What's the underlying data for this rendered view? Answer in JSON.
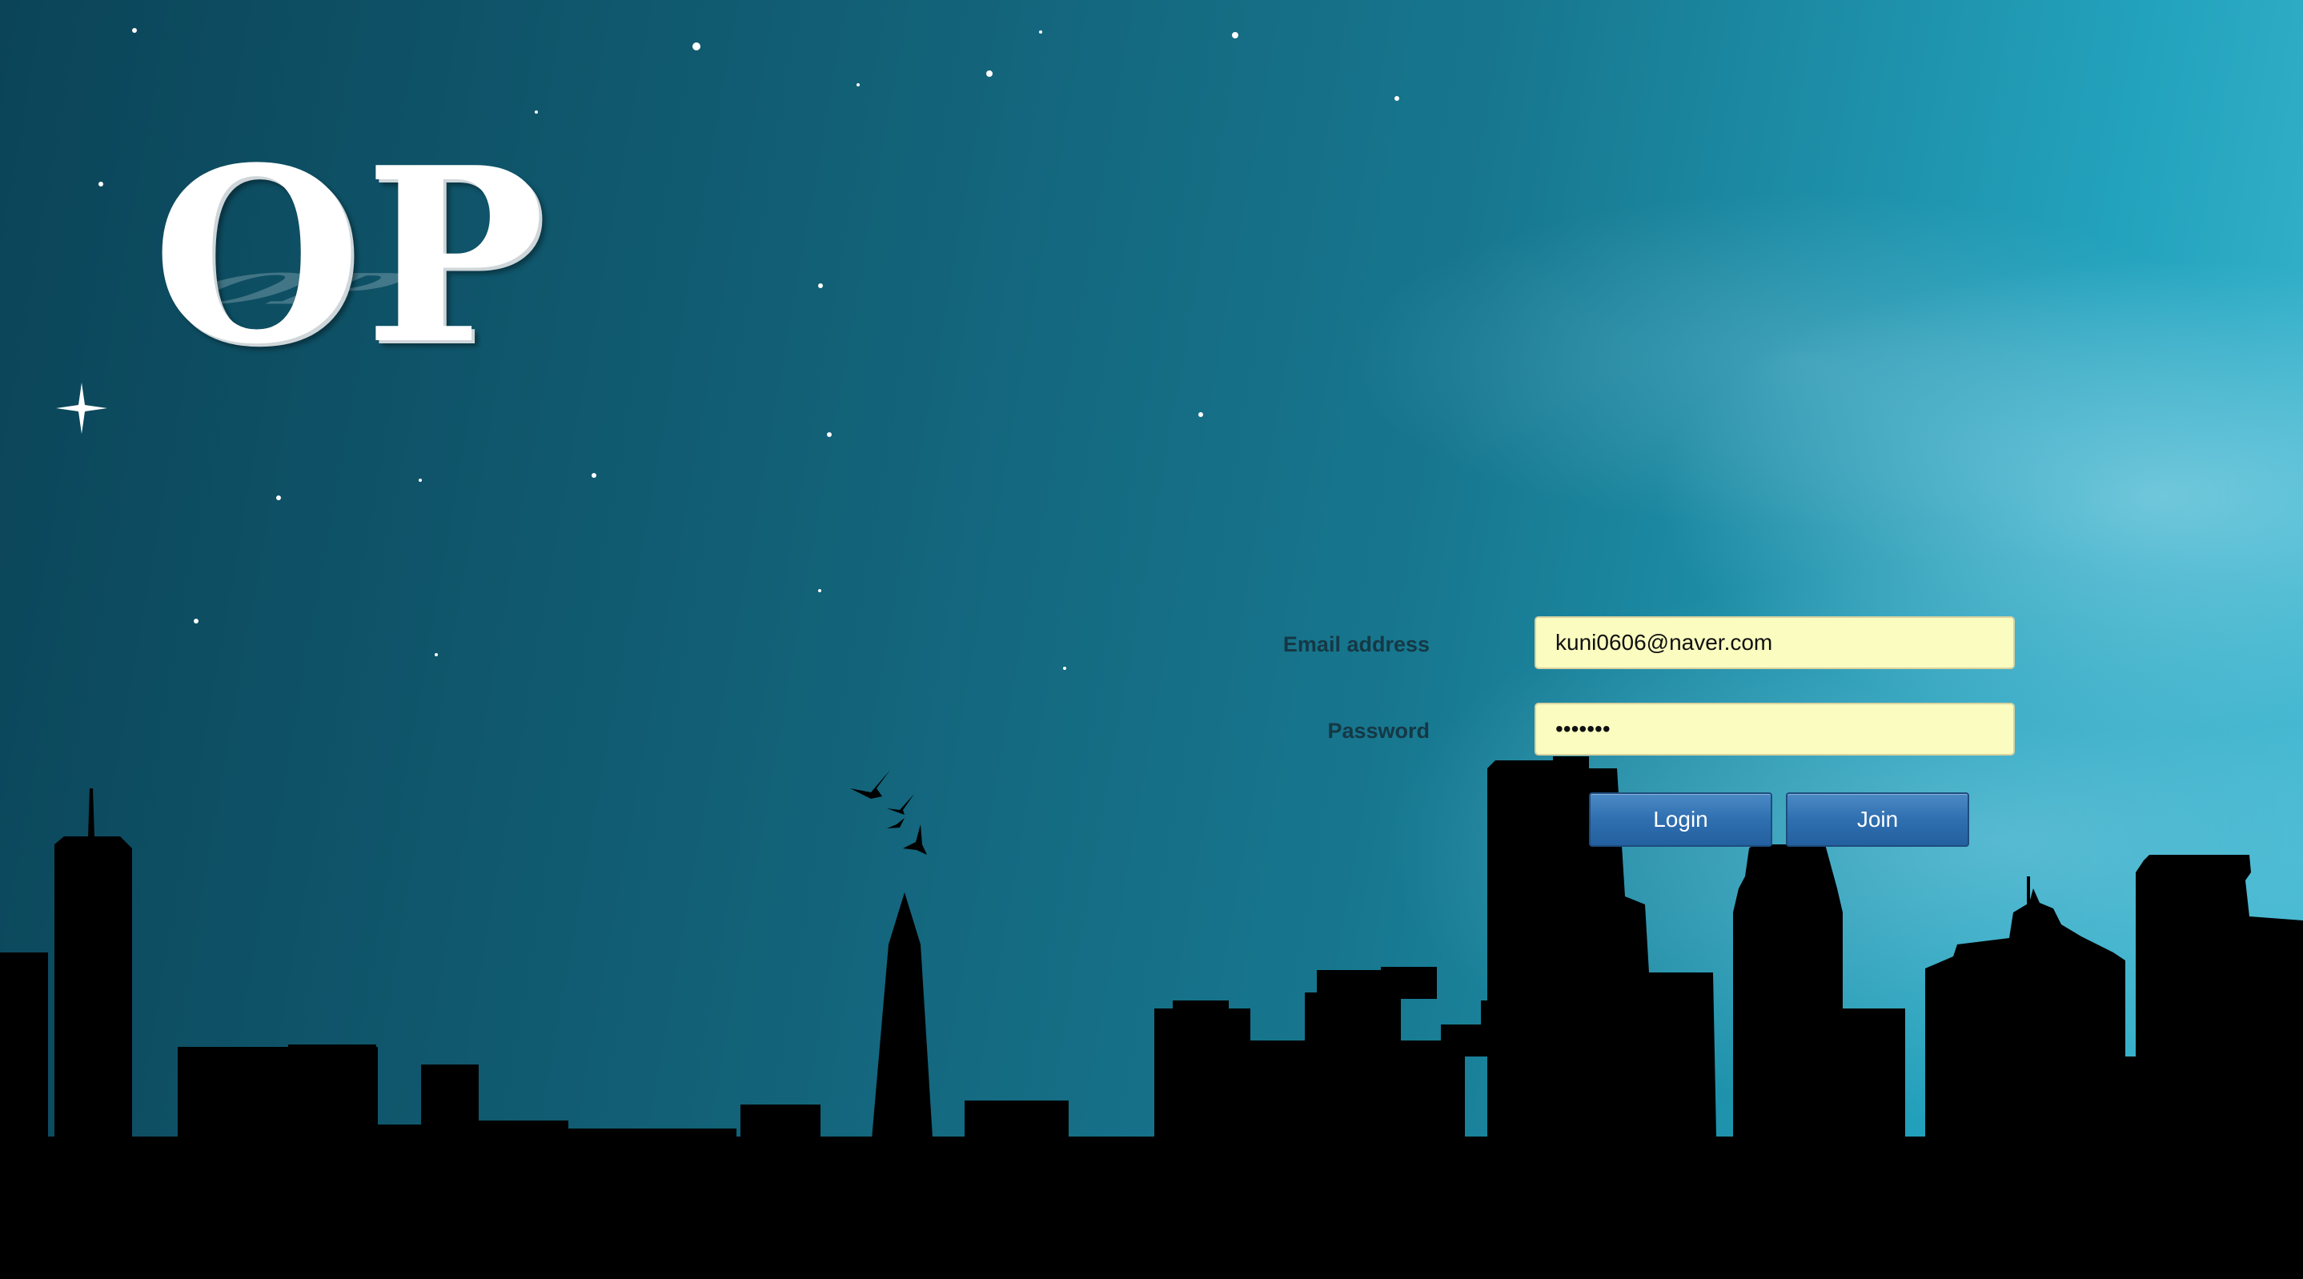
{
  "logo": {
    "text": "OP"
  },
  "form": {
    "email_label": "Email address",
    "email_value": "kuni0606@naver.com",
    "password_label": "Password",
    "password_value": "•••••••",
    "login_label": "Login",
    "join_label": "Join"
  },
  "colors": {
    "input_background": "#fafcc0",
    "button_blue": "#2f6fb0",
    "skyline": "#000000",
    "sky_dark": "#0b4458",
    "sky_light": "#3cb8d1"
  }
}
